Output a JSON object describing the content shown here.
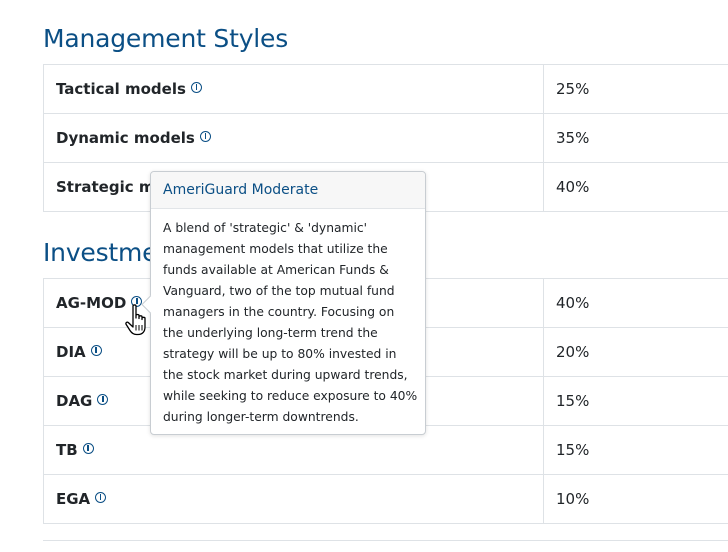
{
  "management": {
    "title": "Management Styles",
    "rows": [
      {
        "name": "Tactical models",
        "value": "25%"
      },
      {
        "name": "Dynamic models",
        "value": "35%"
      },
      {
        "name": "Strategic models",
        "value": "40%"
      }
    ]
  },
  "investments": {
    "title": "Investments",
    "rows": [
      {
        "name": "AG-MOD",
        "value": "40%"
      },
      {
        "name": "DIA",
        "value": "20%"
      },
      {
        "name": "DAG",
        "value": "15%"
      },
      {
        "name": "TB",
        "value": "15%"
      },
      {
        "name": "EGA",
        "value": "10%"
      }
    ]
  },
  "popover": {
    "title": "AmeriGuard Moderate",
    "lines": [
      "A blend of 'strategic' & 'dynamic'",
      "management models that utilize the",
      "funds available at American Funds &",
      "Vanguard, two of the top mutual fund",
      "managers in the country. Focusing on",
      "the underlying long-term trend the",
      "strategy will be up to 80% invested in",
      "the stock market during upward trends,",
      "while seeking to reduce exposure to 40%",
      "during longer-term downtrends."
    ]
  },
  "icons": {
    "info": "info-circle-icon",
    "cursor": "hand-pointer-cursor"
  },
  "colors": {
    "heading": "#0b4f85",
    "border": "#dee2e6",
    "text": "#212529"
  }
}
